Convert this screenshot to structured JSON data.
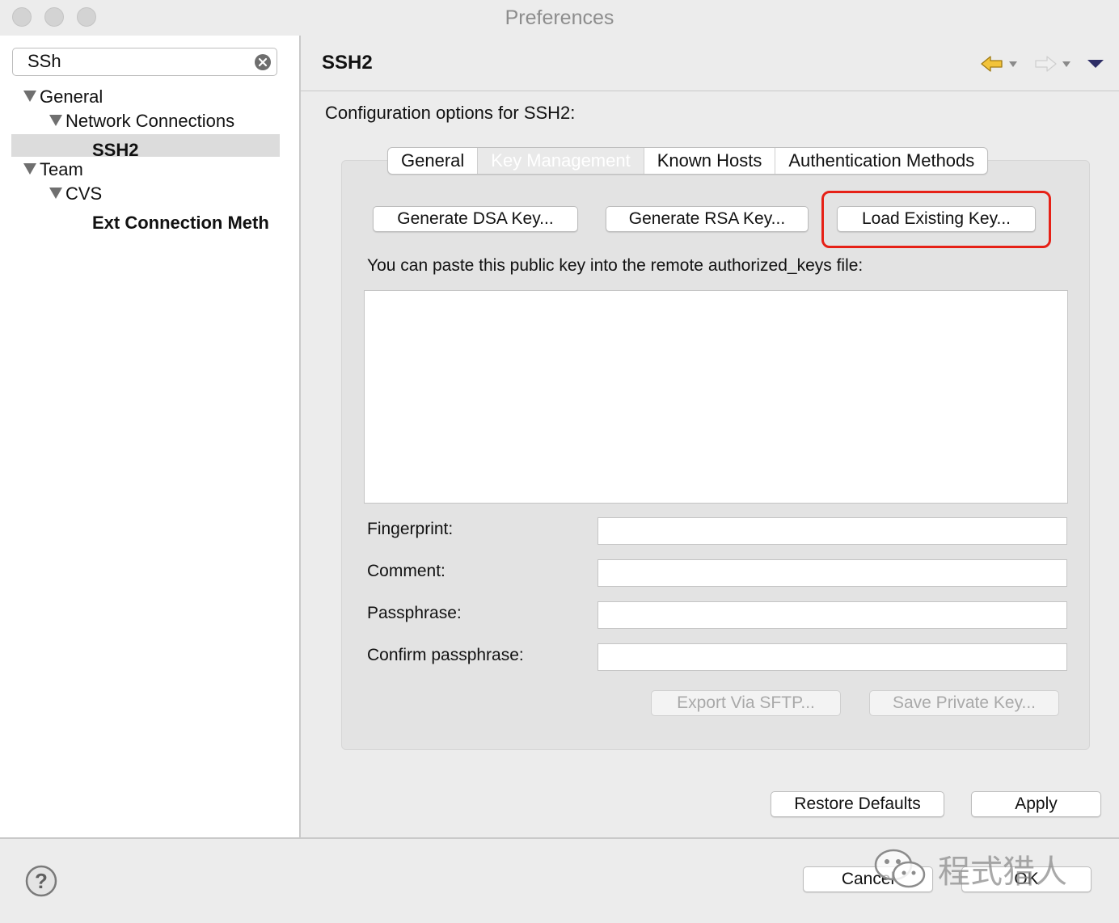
{
  "window": {
    "title": "Preferences"
  },
  "sidebar": {
    "filter_value": "SSh",
    "tree": {
      "general": "General",
      "network_connections": "Network Connections",
      "ssh2": "SSH2",
      "team": "Team",
      "cvs": "CVS",
      "ext_connection": "Ext Connection Meth"
    }
  },
  "page": {
    "title": "SSH2",
    "description": "Configuration options for SSH2:"
  },
  "tabs": [
    "General",
    "Key Management",
    "Known Hosts",
    "Authentication Methods"
  ],
  "active_tab": "Key Management",
  "key_management": {
    "generate_dsa": "Generate DSA Key...",
    "generate_rsa": "Generate RSA Key...",
    "load_existing": "Load Existing Key...",
    "paste_label": "You can paste this public key into the remote authorized_keys file:",
    "public_key_value": "",
    "fingerprint_label": "Fingerprint:",
    "fingerprint_value": "",
    "comment_label": "Comment:",
    "comment_value": "",
    "passphrase_label": "Passphrase:",
    "passphrase_value": "",
    "confirm_label": "Confirm passphrase:",
    "confirm_value": "",
    "export_sftp": "Export Via SFTP...",
    "save_private": "Save Private Key..."
  },
  "actions": {
    "restore_defaults": "Restore Defaults",
    "apply": "Apply",
    "cancel": "Cancel",
    "ok": "OK"
  },
  "watermark": {
    "text": "程式猎人"
  },
  "colors": {
    "highlight_border": "#e62117",
    "selection_bg": "#dcdcdc",
    "nav_back_arrow": "#f2c33a"
  }
}
